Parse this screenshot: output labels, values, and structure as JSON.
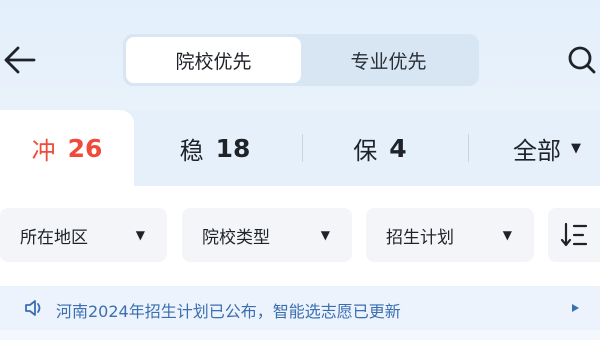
{
  "header": {
    "segments": [
      {
        "label": "院校优先",
        "active": true
      },
      {
        "label": "专业优先",
        "active": false
      }
    ],
    "back_icon": "arrow-left-icon",
    "search_icon": "search-icon"
  },
  "tabs": {
    "rush": {
      "label": "冲",
      "count": "26",
      "color": "#ef4b3b"
    },
    "stable": {
      "label": "稳",
      "count": "18"
    },
    "safe": {
      "label": "保",
      "count": "4"
    },
    "all": {
      "label": "全部"
    }
  },
  "filters": {
    "region": "所在地区",
    "school_type": "院校类型",
    "enrollment_plan": "招生计划",
    "sort_icon": "sort-icon"
  },
  "notice": {
    "text": "河南2024年招生计划已公布，智能选志愿已更新",
    "speaker_icon": "speaker-icon"
  },
  "colors": {
    "accent_red": "#ef4b3b",
    "notice_blue": "#3a6fb0"
  }
}
